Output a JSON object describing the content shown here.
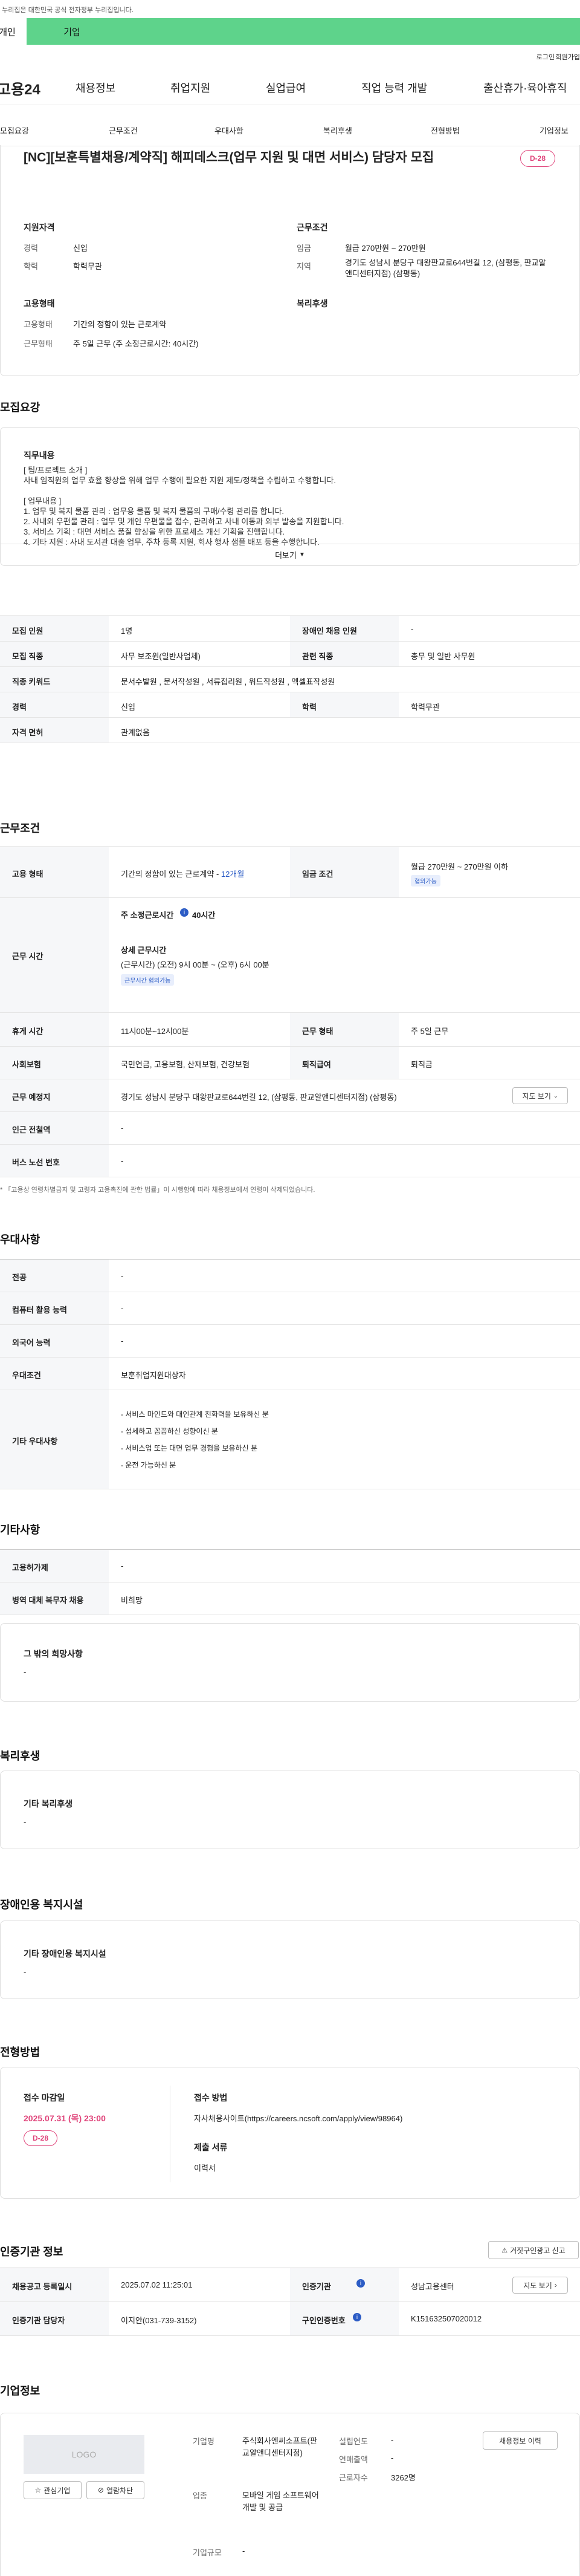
{
  "gov_banner": "이 누리집은 대한민국 공식 전자정부 누리집입니다.",
  "top_tabs": [
    "개인",
    "기업"
  ],
  "util_links": [
    "로그인",
    "회원가입"
  ],
  "logo": "고용24",
  "gnb": [
    "채용정보",
    "취업지원",
    "실업급여",
    "직업 능력 개발",
    "출산휴가·육아휴직"
  ],
  "snb": [
    "모집요강",
    "근무조건",
    "우대사항",
    "복리후생",
    "전형방법",
    "기업정보"
  ],
  "job": {
    "title": "[NC][보훈특별채용/계약직] 해피데스크(업무 지원 및 대면 서비스) 담당자 모집",
    "dday": "D-28",
    "qual_title": "지원자격",
    "qual": [
      {
        "k": "경력",
        "v": "신입"
      },
      {
        "k": "학력",
        "v": "학력무관"
      }
    ],
    "emp_title": "고용형태",
    "emp": [
      {
        "k": "고용형태",
        "v": "기간의 정함이 있는 근로계약"
      },
      {
        "k": "근무형태",
        "v": "주 5일 근무 (주 소정근로시간: 40시간)"
      }
    ],
    "cond_title": "근무조건",
    "cond": [
      {
        "k": "임금",
        "v": "월급 270만원 ~ 270만원"
      },
      {
        "k": "지역",
        "v": "경기도 성남시 분당구 대왕판교로644번길 12, (삼평동, 판교알앤디센터지점) (삼평동)"
      }
    ],
    "welfare_title": "복리후생"
  },
  "recruit": {
    "section": "모집요강",
    "duty_title": "직무내용",
    "duty_lines": [
      "[ 팀/프로젝트 소개 ]",
      "사내 임직원의 업무 효율 향상을 위해 업무 수행에 필요한 지원 제도/정책을 수립하고 수행합니다.",
      "",
      "[ 업무내용 ]",
      "1. 업무 및 복지 물품 관리 : 업무용 물품 및 복지 물품의 구매/수령 관리를 합니다.",
      "2. 사내외 우편물 관리 : 업무 및 개인 우편물을 접수, 관리하고 사내 이동과 외부 발송을 지원합니다.",
      "3. 서비스 기획 : 대면 서비스 품질 향상을 위한 프로세스 개선 기획을 진행합니다.",
      "4. 기타 지원 : 사내 도서관 대출 업무, 주차 등록 지원, 회사 행사 샘플 배포 등을 수행합니다."
    ],
    "more": "더보기",
    "rows": [
      {
        "k1": "모집 인원",
        "v1": "1명",
        "k2": "장애인 채용 인원",
        "v2": "-"
      },
      {
        "k1": "모집 직종",
        "v1": "사무 보조원(일반사업체)",
        "k2": "관련 직종",
        "v2": "총무 및 일반 사무원"
      },
      {
        "k1": "직종 키워드",
        "v1": "문서수발원 , 문서작성원 , 서류접리원 , 워드작성원 , 엑셀표작성원",
        "k2": "",
        "v2": ""
      },
      {
        "k1": "경력",
        "v1": "신입",
        "k2": "학력",
        "v2": "학력무관"
      },
      {
        "k1": "자격 면허",
        "v1": "관계없음",
        "k2": "",
        "v2": ""
      }
    ]
  },
  "work": {
    "section": "근무조건",
    "emp_k": "고용 형태",
    "emp_v": "기간의 정함이 있는 근로계약 - ",
    "emp_months": "12개월",
    "pay_k": "임금 조건",
    "pay_v": "월급 270만원 ~ 270만원 이하",
    "pay_tag": "협의가능",
    "time_k": "근무 시간",
    "time_week": "주 소정근로시간",
    "time_week_v": "40시간",
    "time_detail_t": "상세 근무시간",
    "time_detail_v": "(근무시간) (오전) 9시 00분 ~ (오후) 6시 00분",
    "time_tag": "근무시간 협의가능",
    "rows": [
      {
        "k1": "휴게 시간",
        "v1": "11시00분~12시00분",
        "k2": "근무 형태",
        "v2": "주 5일 근무"
      },
      {
        "k1": "사회보험",
        "v1": "국민연금, 고용보험, 산재보험, 건강보험",
        "k2": "퇴직급여",
        "v2": "퇴직금"
      }
    ],
    "loc_k": "근무 예정지",
    "loc_v": "경기도 성남시 분당구 대왕판교로644번길 12, (삼평동, 판교알앤디센터지점) (삼평동)",
    "map_btn": "지도 보기",
    "subway_k": "인근 전철역",
    "subway_v": "-",
    "bus_k": "버스 노선 번호",
    "bus_v": "-",
    "note": "「고용상 연령차별금지 및 고령자 고용촉진에 관한 법률」이 시행함에 따라 채용정보에서 연령이 삭제되었습니다."
  },
  "pref": {
    "section": "우대사항",
    "rows": [
      {
        "k": "전공",
        "v": "-"
      },
      {
        "k": "컴퓨터 활용 능력",
        "v": "-"
      },
      {
        "k": "외국어 능력",
        "v": "-"
      },
      {
        "k": "우대조건",
        "v": "보훈취업지원대상자"
      }
    ],
    "etc_k": "기타 우대사항",
    "etc_v": [
      "- 서비스 마인드와 대인관계 친화력을 보유하신 분",
      "- 섬세하고 꼼꼼하신 성향이신 분",
      "- 서비스업 또는 대면 업무 경험을 보유하신 분",
      "- 운전 가능하신 분"
    ]
  },
  "other": {
    "section": "기타사항",
    "rows": [
      {
        "k": "고용허가제",
        "v": "-"
      },
      {
        "k": "병역 대체 복무자 채용",
        "v": "비희망"
      }
    ],
    "wish_t": "그 밖의 희망사항",
    "wish_v": "-"
  },
  "benefit": {
    "section": "복리후생",
    "t": "기타 복리후생",
    "v": "-"
  },
  "disabled": {
    "section": "장애인용 복지시설",
    "t": "기타 장애인용 복지시설",
    "v": "-"
  },
  "process": {
    "section": "전형방법",
    "deadline_t": "접수 마감일",
    "deadline_v": "2025.07.31 (목) 23:00",
    "dday": "D-28",
    "method_t": "접수 방법",
    "method_v": "자사채용사이트(https://careers.ncsoft.com/apply/view/98964)",
    "docs_t": "제출 서류",
    "docs_v": "이력서"
  },
  "auth": {
    "section": "인증기관 정보",
    "report_btn": "거짓구인광고 신고",
    "rows": [
      {
        "k1": "채용공고 등록일시",
        "v1": "2025.07.02 11:25:01",
        "k2": "인증기관",
        "v2": "성남고용센터",
        "btn": "지도 보기"
      },
      {
        "k1": "인증기관 담당자",
        "v1": "이지안(031-739-3152)",
        "k2": "구인인증번호",
        "v2": "K151632507020012",
        "btn": ""
      }
    ]
  },
  "company": {
    "section": "기업정보",
    "logo": "LOGO",
    "fav": "관심기업",
    "block": "열람차단",
    "name_k": "기업명",
    "name_v": "주식회사엔씨소프트(판교알앤디센터지점)",
    "biz_k": "업종",
    "biz_v": "모바일 게임 소프트웨어 개발 및 공급",
    "size_k": "기업규모",
    "size_v": "-",
    "est_k": "설립연도",
    "est_v": "-",
    "rev_k": "연매출액",
    "rev_v": "-",
    "emp_k": "근로자수",
    "emp_v": "3262명",
    "jobs_btn": "채용정보 이력"
  }
}
